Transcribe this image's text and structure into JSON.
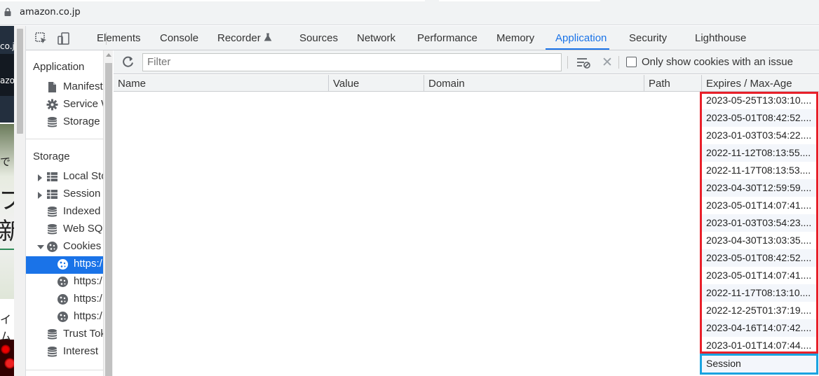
{
  "browser": {
    "url": "amazon.co.jp"
  },
  "website": {
    "text1": "co.j",
    "text2": "azo",
    "jp1": "で",
    "jp2": "フ",
    "jp3": "新",
    "jp4": "イム"
  },
  "devtools": {
    "tabs": [
      "Elements",
      "Console",
      "Recorder",
      "Sources",
      "Network",
      "Performance",
      "Memory",
      "Application",
      "Security",
      "Lighthouse"
    ],
    "active_tab": "Application"
  },
  "sidebar": {
    "application_header": "Application",
    "app_items": [
      "Manifest",
      "Service W",
      "Storage"
    ],
    "storage_header": "Storage",
    "storage_items": [
      "Local Sto",
      "Session",
      "Indexed",
      "Web SQ",
      "Cookies"
    ],
    "cookie_items": [
      "https:/",
      "https:/",
      "https:/",
      "https:/"
    ],
    "other_items": [
      "Trust Tok",
      "Interest"
    ]
  },
  "toolbar": {
    "filter_placeholder": "Filter",
    "only_issue_label": "Only show cookies with an issue"
  },
  "table": {
    "columns": [
      "Name",
      "Value",
      "Domain",
      "Path",
      "Expires / Max-Age"
    ],
    "expires": [
      "2023-05-25T13:03:10....",
      "2023-05-01T08:42:52....",
      "2023-01-03T03:54:22....",
      "2022-11-12T08:13:55....",
      "2022-11-17T08:13:53....",
      "2023-04-30T12:59:59....",
      "2023-05-01T14:07:41....",
      "2023-01-03T03:54:23....",
      "2023-04-30T13:03:35....",
      "2023-05-01T08:42:52....",
      "2023-05-01T14:07:41....",
      "2022-11-17T08:13:10....",
      "2022-12-25T01:37:19....",
      "2023-04-16T14:07:42....",
      "2023-01-01T14:07:44....",
      "Session"
    ]
  },
  "colors": {
    "accent": "#1a73e8",
    "highlight_red": "#e8202a",
    "highlight_blue": "#1aa3e0"
  }
}
